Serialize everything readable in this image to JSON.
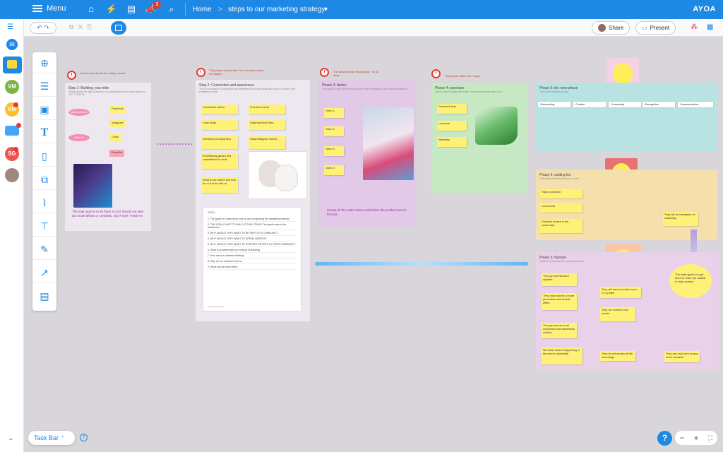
{
  "topbar": {
    "menu_label": "Menu",
    "notification_count": "3",
    "breadcrumb_home": "Home",
    "breadcrumb_sep": ">",
    "breadcrumb_current": "steps to our marketing strategy",
    "logo": "AYOA"
  },
  "sidebar": {
    "avatars": [
      "VM",
      "VM",
      "SG"
    ]
  },
  "toolbar": {
    "share_label": "Share",
    "present_label": "Present"
  },
  "panels": {
    "p1": {
      "clock_note": "Instant and should be a daily content",
      "title": "Step 1: Building your tribe",
      "subtitle": "These should be daily content in our marketing and the main goal is to GET THEM IN",
      "root_a": "Build audience",
      "root_b": "Build list",
      "tags": [
        "Facebook",
        "Instagram",
        "Circle",
        "Email list"
      ],
      "bottom_text": "The main goal is to let them in so it should not take too much efforts or creativity. JUST GET THEM IN"
    },
    "p2": {
      "clock_note": "This phase should last 3 to 4 months before the launch",
      "title": "Step 2: Connection and awareness",
      "subtitle": "This is the phase of connection and awareness and this should take up to 3 months and sometimes more",
      "stickies": [
        "Connection videos",
        "Free live events",
        "Case study",
        "Daily facebook lives",
        "Interviews of customers",
        "Daily instagram stories",
        "Entertaining games and competitions in circle",
        "What is our culture and how fun is it to be with us"
      ],
      "goal_title": "GOAL",
      "goal_items": [
        "1. The goal is to make them love us and consuming the marketing material",
        "2. THE GOAL IS NOT TO SALE AT THIS STAGE! The goal is also to be awareness",
        "3. WHY WOULD THEY WANT TO BE PART OF A COMMUNITY",
        "4. WHY WOULD THEY WANT TO SPEND MONTHLY",
        "5. WHY WOULD THEY WANT TO SUPPORT ARTISTS IN THEIR COMMUNITY",
        "6. What is provided with our method of teaching",
        "7. How are our customer thinking",
        "8. Why do our customer love us",
        "9. What can we teach them"
      ],
      "goal_footer": "Add key text here"
    },
    "p3": {
      "clock_note": "The desire phase should last 7 to 10 days",
      "title": "Phase 3: desire",
      "subtitle": "The goal is to get them fired up about what is coming up and build anticipation",
      "stickies": [
        "Video 1",
        "Video 2",
        "Video 3",
        "Video 4"
      ],
      "bottom_text": "Create all the sales videos and follow the product launch formula"
    },
    "p4": {
      "clock_note": "This phase lasts 4 to 7 days",
      "title": "Phase 4: purchase",
      "subtitle": "This is where people will make a purchase decision yes or no",
      "stickies": [
        "Facebook lives",
        "Livecasts",
        "Webinars"
      ]
    },
    "p6": {
      "title": "Phase 6: the wow phase",
      "subtitle": "This is the retention phase",
      "tags": [
        "Onboarding",
        "Content",
        "Community",
        "Recognition",
        "Communication"
      ]
    },
    "p5": {
      "title": "Phase 5: waiting list",
      "subtitle": "This will be the fast amount to come",
      "stickies": [
        "Flash promotion",
        "Live events",
        "Potential access to the community"
      ],
      "side_note": "They will be retargeted for marketing"
    },
    "p7": {
      "title": "Phase 5: Nurture",
      "subtitle": "Continue the connection and awareness",
      "stickies": [
        "They get normal store updates",
        "They have access to store promotions and bundle offers",
        "They get access to all connection and awareness content",
        "We share what is happening in the secret community",
        "They will have an invite to join C-HQ tribe",
        "They are invited to live events",
        "They do not access all the recordings",
        "They can only have access to the research"
      ],
      "goal_bubble": "The main goal is to get them to enter the waitlist or take access"
    }
  },
  "bottom": {
    "taskbar_label": "Task Bar",
    "help": "?",
    "zoom_out": "−",
    "zoom_in": "+"
  },
  "colors": {
    "accent": "#1e88e5",
    "badge": "#e53935"
  }
}
